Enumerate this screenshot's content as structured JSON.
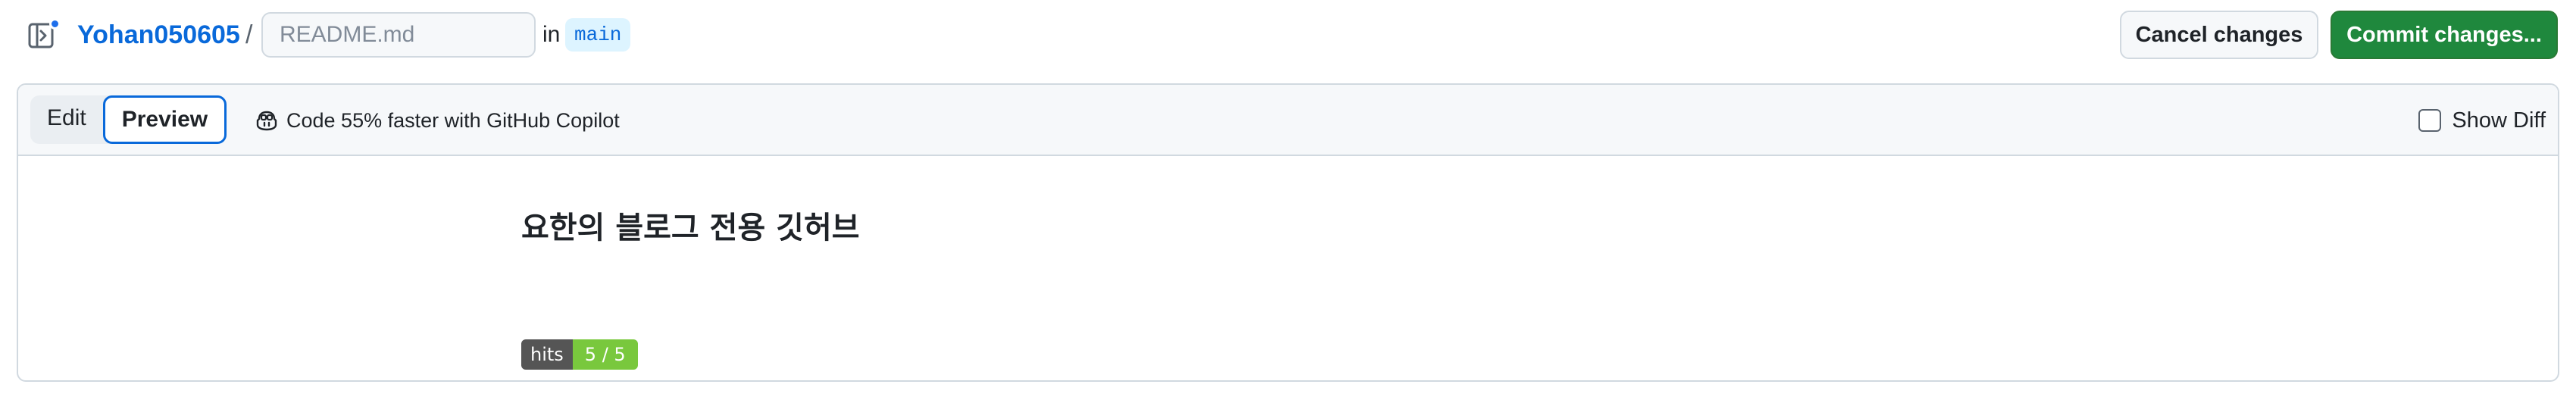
{
  "header": {
    "owner": "Yohan050605",
    "separator": "/",
    "filename_placeholder": "README.md",
    "in_label": "in",
    "branch": "main",
    "cancel_label": "Cancel changes",
    "commit_label": "Commit changes..."
  },
  "editor": {
    "tabs": [
      {
        "label": "Edit",
        "active": false
      },
      {
        "label": "Preview",
        "active": true
      }
    ],
    "copilot_label": "Code 55% faster with GitHub Copilot",
    "show_diff_label": "Show Diff",
    "show_diff_checked": false
  },
  "preview": {
    "title": "요한의 블로그 전용 깃허브",
    "badge": {
      "label": "hits",
      "value": "5 / 5"
    }
  },
  "colors": {
    "link": "#0969da",
    "commit_button": "#1f883d",
    "badge_left": "#555555",
    "badge_right": "#79c83d",
    "notification_dot": "#1f6feb"
  },
  "icons": {
    "sidebar_toggle": "sidebar-expand-icon",
    "copilot": "copilot-icon"
  }
}
